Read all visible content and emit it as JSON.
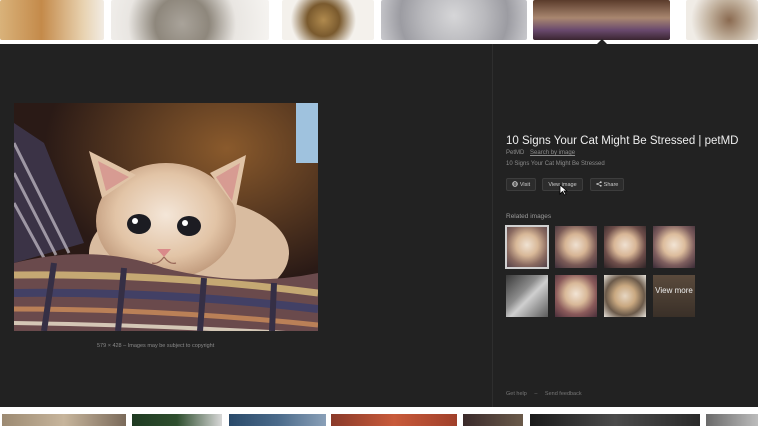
{
  "image_preview": {
    "dimensions": "579 × 428",
    "copyright_notice": "Images may be subject to copyright"
  },
  "result": {
    "title": "10 Signs Your Cat Might Be Stressed | petMD",
    "source": "PetMD",
    "search_by_image": "Search by image",
    "description": "10 Signs Your Cat Might Be Stressed"
  },
  "actions": {
    "visit": "Visit",
    "view_image": "View image",
    "share": "Share"
  },
  "related": {
    "label": "Related images",
    "view_more": "View more"
  },
  "footer": {
    "get_help": "Get help",
    "send_feedback": "Send feedback"
  },
  "colors": {
    "panel_bg": "#222222",
    "title_text": "#eeeeee",
    "muted_text": "#8c8c8c"
  }
}
